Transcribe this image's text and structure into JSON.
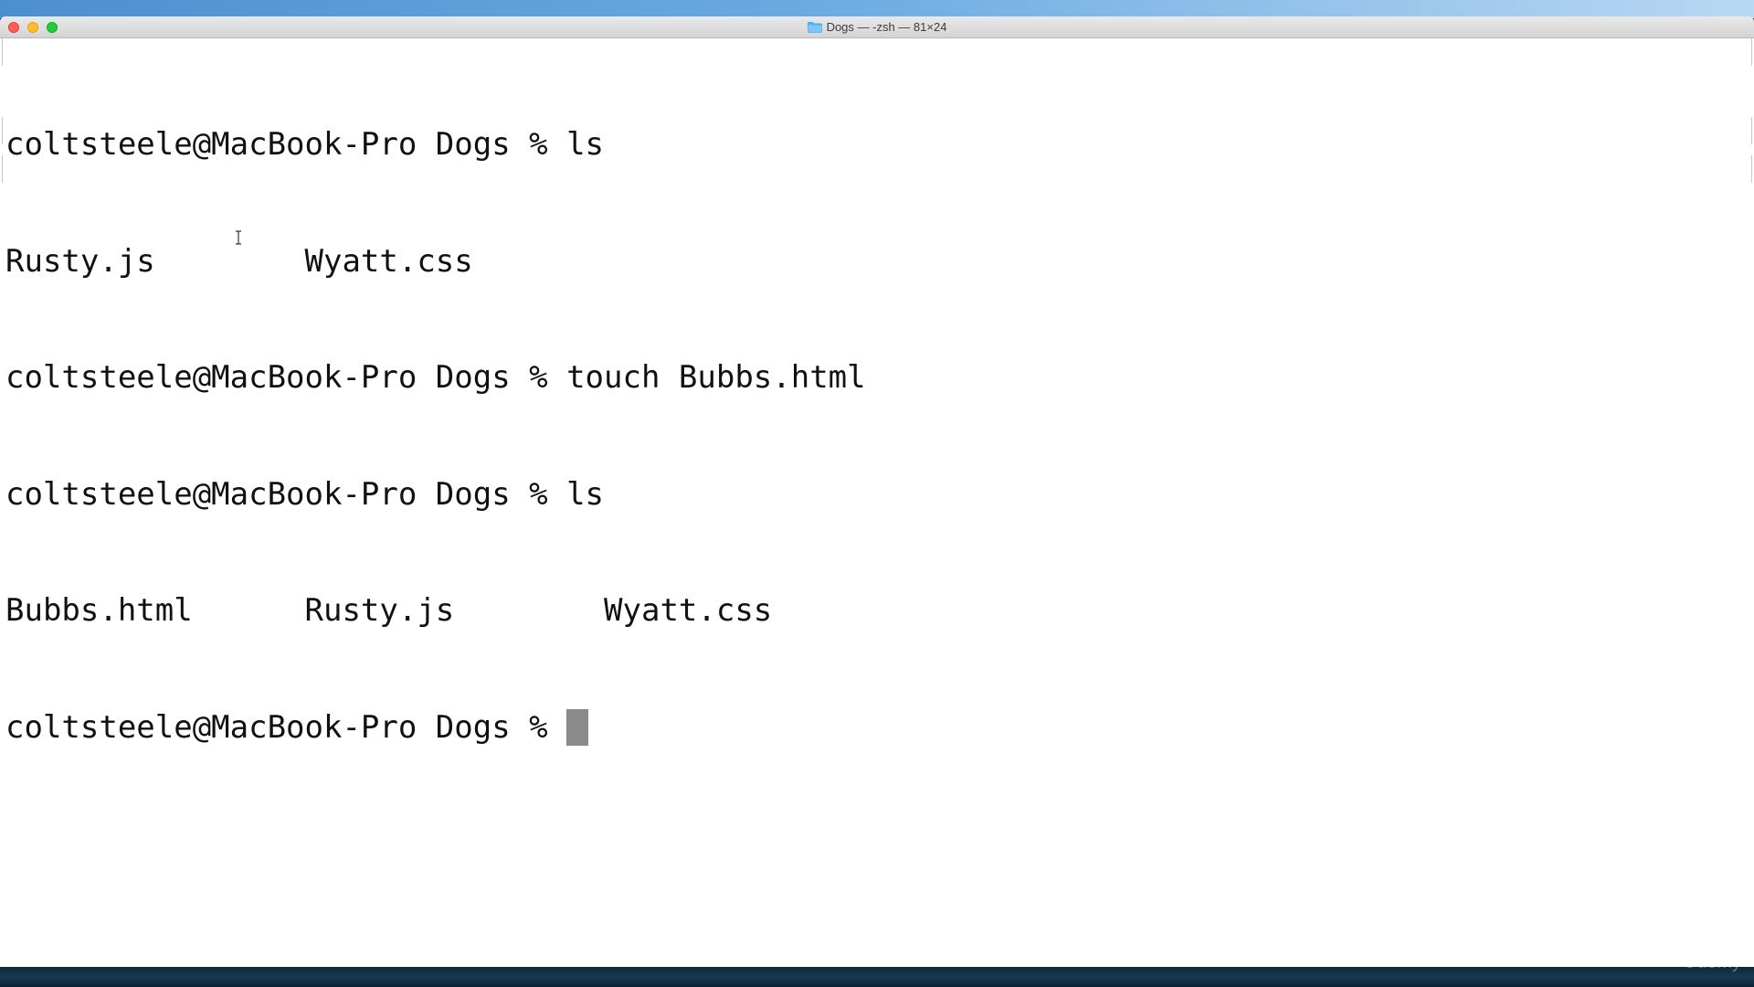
{
  "window": {
    "title": "Dogs — -zsh — 81×24",
    "folder_icon": "folder-icon"
  },
  "terminal": {
    "lines": [
      "coltsteele@MacBook-Pro Dogs % ls",
      "Rusty.js        Wyatt.css",
      "coltsteele@MacBook-Pro Dogs % touch Bubbs.html",
      "coltsteele@MacBook-Pro Dogs % ls",
      "Bubbs.html      Rusty.js        Wyatt.css"
    ],
    "prompt": "coltsteele@MacBook-Pro Dogs % "
  },
  "colors": {
    "close": "#fe5f57",
    "minimize": "#febc2e",
    "maximize": "#28c840",
    "text": "#111111",
    "cursor": "#8a8a8a"
  },
  "watermark": "Udemy"
}
